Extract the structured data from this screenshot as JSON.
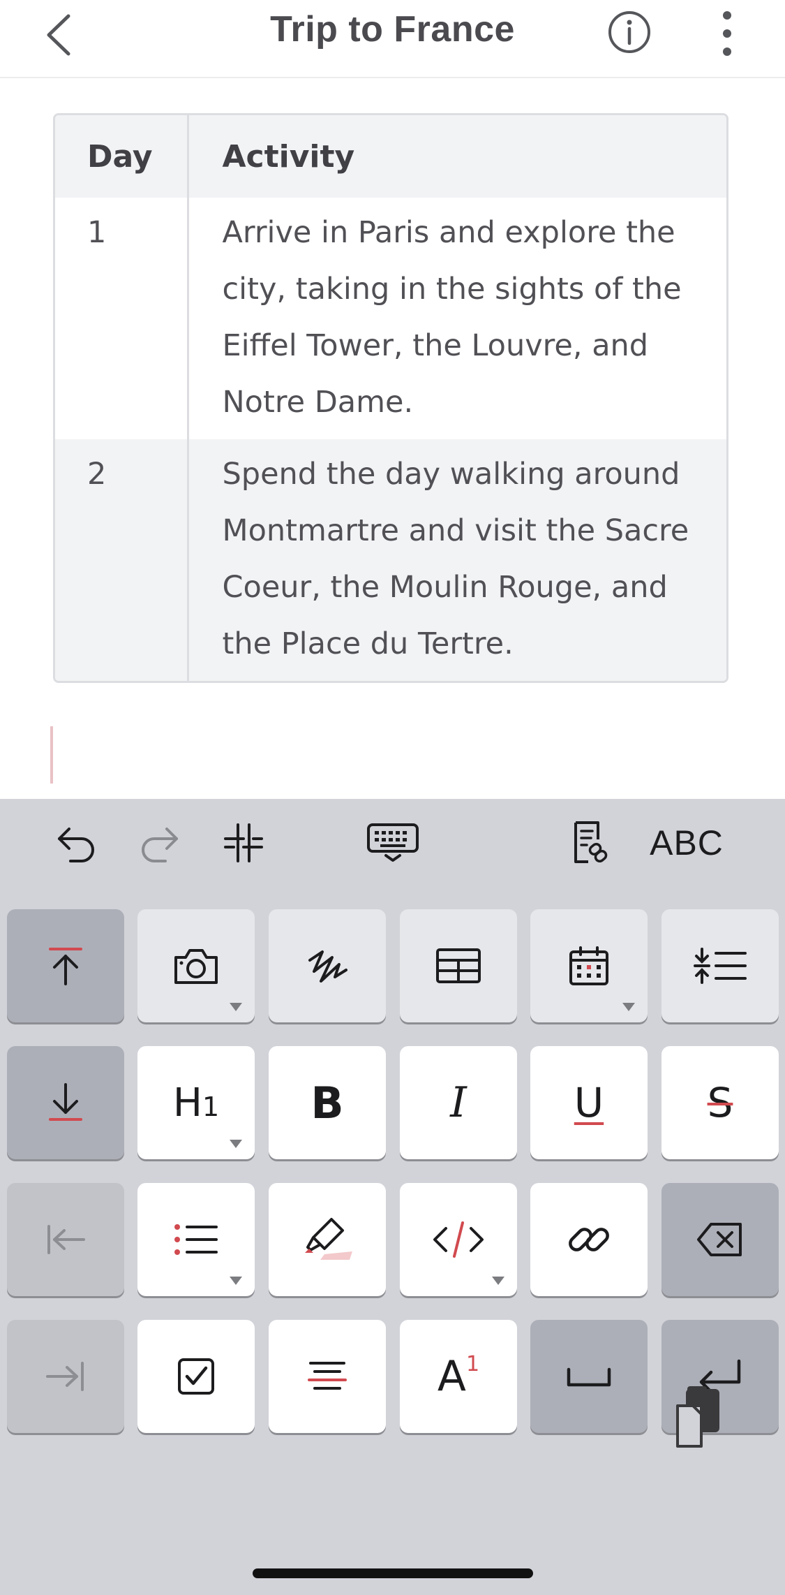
{
  "header": {
    "title": "Trip to France"
  },
  "table": {
    "headers": [
      "Day",
      "Activity"
    ],
    "rows": [
      {
        "day": "1",
        "activity_lines": [
          "Arrive in Paris and explore the",
          "city, taking in the sights of the",
          "Eiffel Tower, the Louvre, and",
          "Notre Dame."
        ]
      },
      {
        "day": "2",
        "activity_lines": [
          "Spend the day walking around",
          "Montmartre and visit the Sacre",
          "Coeur, the Moulin Rouge, and",
          "the Place du Tertre."
        ]
      }
    ]
  },
  "toolbar": {
    "items": [
      "undo-icon",
      "redo-icon",
      "format-grid-icon",
      "keyboard-icon",
      "note-link-icon"
    ],
    "abc_label": "ABC"
  },
  "keys": {
    "heading_label": "H1",
    "heading_main": "H",
    "heading_sub": "1",
    "bold_label": "B",
    "italic_label": "I",
    "underline_label": "U",
    "strike_label": "S",
    "superscript_main": "A",
    "superscript_sup": "1"
  },
  "colors": {
    "accent": "#d14a4f",
    "keyboard_bg": "#d2d3d9",
    "key_dark": "#adafb8",
    "table_border": "#dcdde0"
  }
}
